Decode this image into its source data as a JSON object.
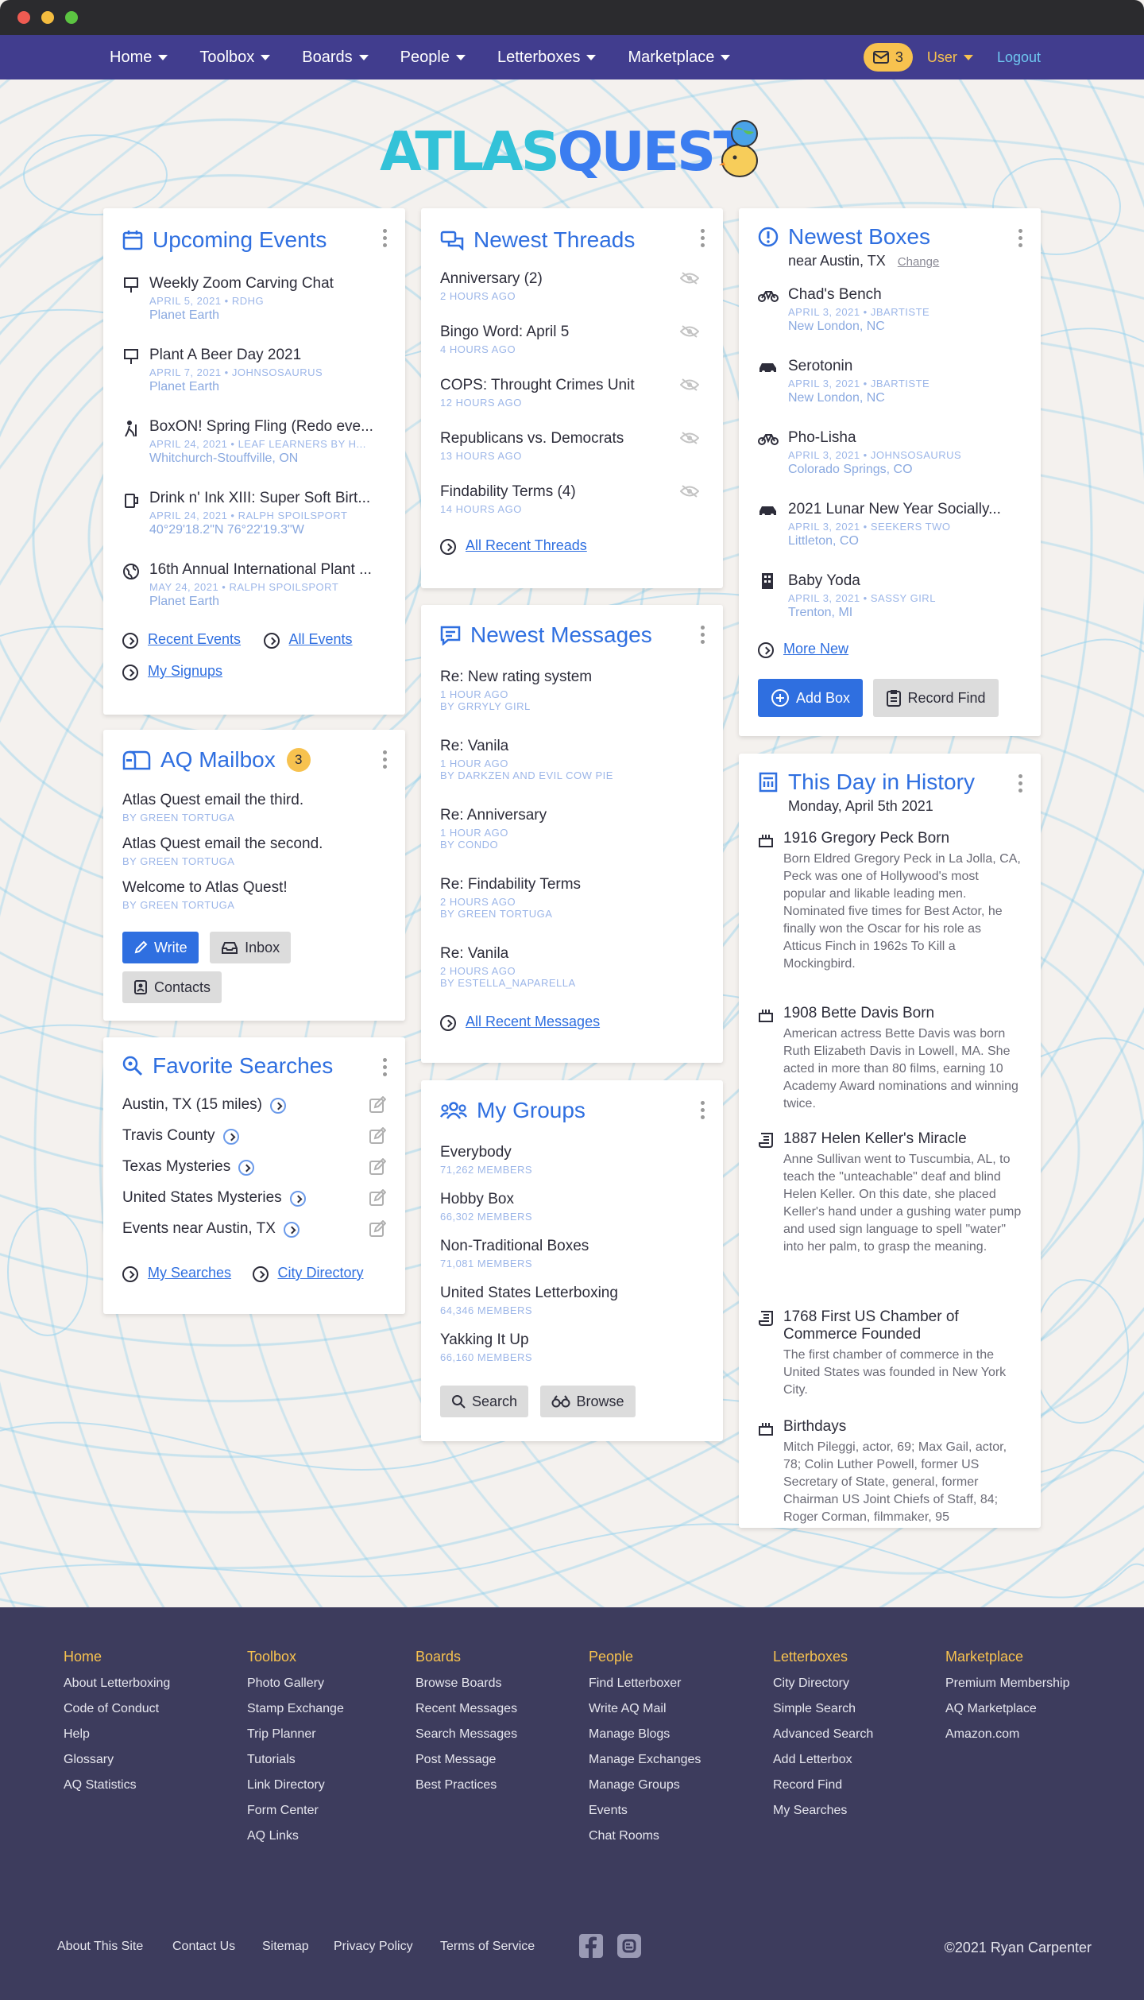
{
  "nav": {
    "items": [
      "Home",
      "Toolbox",
      "Boards",
      "People",
      "Letterboxes",
      "Marketplace"
    ],
    "mail_count": "3",
    "user": "User",
    "logout": "Logout"
  },
  "logo": {
    "part1": "ATLAS",
    "part2": "QUEST"
  },
  "events": {
    "title": "Upcoming Events",
    "items": [
      {
        "title": "Weekly Zoom Carving Chat",
        "meta": "APRIL 5, 2021 • RDHG",
        "loc": "Planet Earth"
      },
      {
        "title": "Plant A Beer Day 2021",
        "meta": "APRIL 7, 2021 • JOHNSOSAURUS",
        "loc": "Planet Earth"
      },
      {
        "title": "BoxON! Spring Fling (Redo eve...",
        "meta": "APRIL 24, 2021 • LEAF LEARNERS BY H...",
        "loc": "Whitchurch-Stouffville, ON"
      },
      {
        "title": "Drink n' Ink XIII: Super Soft Birt...",
        "meta": "APRIL 24, 2021 • RALPH SPOILSPORT",
        "loc": "40°29'18.2\"N 76°22'19.3\"W"
      },
      {
        "title": "16th Annual International Plant ...",
        "meta": "MAY 24, 2021 • RALPH SPOILSPORT",
        "loc": "Planet Earth"
      }
    ],
    "link_recent": "Recent Events",
    "link_all": "All Events",
    "link_signups": "My Signups"
  },
  "mailbox": {
    "title": "AQ Mailbox",
    "badge": "3",
    "items": [
      {
        "title": "Atlas Quest email the third.",
        "meta": "BY GREEN TORTUGA"
      },
      {
        "title": "Atlas Quest email the second.",
        "meta": "BY GREEN TORTUGA"
      },
      {
        "title": "Welcome to Atlas Quest!",
        "meta": "BY GREEN TORTUGA"
      }
    ],
    "write": "Write",
    "inbox": "Inbox",
    "contacts": "Contacts"
  },
  "searches": {
    "title": "Favorite Searches",
    "items": [
      "Austin, TX (15 miles)",
      "Travis County",
      "Texas Mysteries",
      "United States Mysteries",
      "Events near Austin, TX"
    ],
    "link_my": "My Searches",
    "link_city": "City Directory"
  },
  "threads": {
    "title": "Newest Threads",
    "items": [
      {
        "title": "Anniversary (2)",
        "meta": "2 HOURS AGO"
      },
      {
        "title": "Bingo Word: April 5",
        "meta": "4 HOURS AGO"
      },
      {
        "title": "COPS: Throught Crimes Unit",
        "meta": "12 HOURS AGO"
      },
      {
        "title": "Republicans vs. Democrats",
        "meta": "13 HOURS AGO"
      },
      {
        "title": "Findability Terms (4)",
        "meta": "14 HOURS AGO"
      }
    ],
    "link_all": "All Recent Threads"
  },
  "messages": {
    "title": "Newest Messages",
    "items": [
      {
        "title": "Re: New rating system",
        "meta1": "1 HOUR AGO",
        "meta2": "BY GRRYLY GIRL"
      },
      {
        "title": "Re: Vanila",
        "meta1": "1 HOUR AGO",
        "meta2": "BY DARKZEN AND EVIL COW PIE"
      },
      {
        "title": "Re: Anniversary",
        "meta1": "1 HOUR AGO",
        "meta2": "BY CONDO"
      },
      {
        "title": "Re: Findability Terms",
        "meta1": "2 HOURS AGO",
        "meta2": "BY GREEN TORTUGA"
      },
      {
        "title": "Re: Vanila",
        "meta1": "2 HOURS AGO",
        "meta2": "BY ESTELLA_NAPARELLA"
      }
    ],
    "link_all": "All Recent Messages"
  },
  "groups": {
    "title": "My Groups",
    "items": [
      {
        "title": "Everybody",
        "meta": "71,262 MEMBERS"
      },
      {
        "title": "Hobby Box",
        "meta": "66,302 MEMBERS"
      },
      {
        "title": "Non-Traditional Boxes",
        "meta": "71,081 MEMBERS"
      },
      {
        "title": "United States Letterboxing",
        "meta": "64,346 MEMBERS"
      },
      {
        "title": "Yakking It Up",
        "meta": "66,160 MEMBERS"
      }
    ],
    "search": "Search",
    "browse": "Browse"
  },
  "boxes": {
    "title": "Newest Boxes",
    "subtitle": "near Austin, TX",
    "change": "Change",
    "items": [
      {
        "title": "Chad's Bench",
        "meta": "APRIL 3, 2021 • JBARTISTE",
        "loc": "New London, NC",
        "icon": "bicycle-icon"
      },
      {
        "title": "Serotonin",
        "meta": "APRIL 3, 2021 • JBARTISTE",
        "loc": "New London, NC",
        "icon": "car-icon"
      },
      {
        "title": "Pho-Lisha",
        "meta": "APRIL 3, 2021 • JOHNSOSAURUS",
        "loc": "Colorado Springs, CO",
        "icon": "bicycle-icon"
      },
      {
        "title": "2021 Lunar New Year Socially...",
        "meta": "APRIL 3, 2021 • SEEKERS TWO",
        "loc": "Littleton, CO",
        "icon": "car-icon"
      },
      {
        "title": "Baby Yoda",
        "meta": "APRIL 3, 2021 • SASSY GIRL",
        "loc": "Trenton, MI",
        "icon": "building-icon"
      }
    ],
    "more": "More New",
    "add": "Add Box",
    "record": "Record Find"
  },
  "history": {
    "title": "This Day in History",
    "date": "Monday, April 5th 2021",
    "items": [
      {
        "title": "1916 Gregory Peck Born",
        "body": "Born Eldred Gregory Peck in La Jolla, CA, Peck was one of Hollywood's most popular and likable leading men. Nominated five times for Best Actor, he finally won the Oscar for his role as Atticus Finch in 1962s To Kill a Mockingbird."
      },
      {
        "title": "1908 Bette Davis Born",
        "body": "American actress Bette Davis was born Ruth Elizabeth Davis in Lowell, MA. She acted in more than 80 films, earning 10 Academy Award nominations and winning twice."
      },
      {
        "title": "1887 Helen Keller's Miracle",
        "body": "Anne Sullivan went to Tuscumbia, AL, to teach the \"unteachable\" deaf and blind Helen Keller. On this date, she placed Keller's hand under a gushing water pump and used sign language to spell \"water\" into her palm, to grasp the meaning."
      },
      {
        "title": "1768 First US Chamber of Commerce Founded",
        "body": "The first chamber of commerce in the United States was founded in New York City."
      },
      {
        "title": "Birthdays",
        "body": "Mitch Pileggi, actor, 69; Max Gail, actor, 78; Colin Luther Powell, former US Secretary of State, general, former Chairman US Joint Chiefs of Staff, 84; Roger Corman, filmmaker, 95"
      }
    ]
  },
  "footer": {
    "cols": [
      {
        "head": "Home",
        "links": [
          "About Letterboxing",
          "Code of Conduct",
          "Help",
          "Glossary",
          "AQ Statistics"
        ]
      },
      {
        "head": "Toolbox",
        "links": [
          "Photo Gallery",
          "Stamp Exchange",
          "Trip Planner",
          "Tutorials",
          "Link Directory",
          "Form Center",
          "AQ Links"
        ]
      },
      {
        "head": "Boards",
        "links": [
          "Browse Boards",
          "Recent Messages",
          "Search Messages",
          "Post Message",
          "Best Practices"
        ]
      },
      {
        "head": "People",
        "links": [
          "Find Letterboxer",
          "Write AQ Mail",
          "Manage Blogs",
          "Manage Exchanges",
          "Manage Groups",
          "Events",
          "Chat Rooms"
        ]
      },
      {
        "head": "Letterboxes",
        "links": [
          "City Directory",
          "Simple Search",
          "Advanced Search",
          "Add Letterbox",
          "Record Find",
          "My Searches"
        ]
      },
      {
        "head": "Marketplace",
        "links": [
          "Premium Membership",
          "AQ Marketplace",
          "Amazon.com"
        ]
      }
    ],
    "bottom": [
      "About This Site",
      "Contact Us",
      "Sitemap",
      "Privacy Policy",
      "Terms of Service"
    ],
    "copyright": "©2021 Ryan Carpenter"
  }
}
